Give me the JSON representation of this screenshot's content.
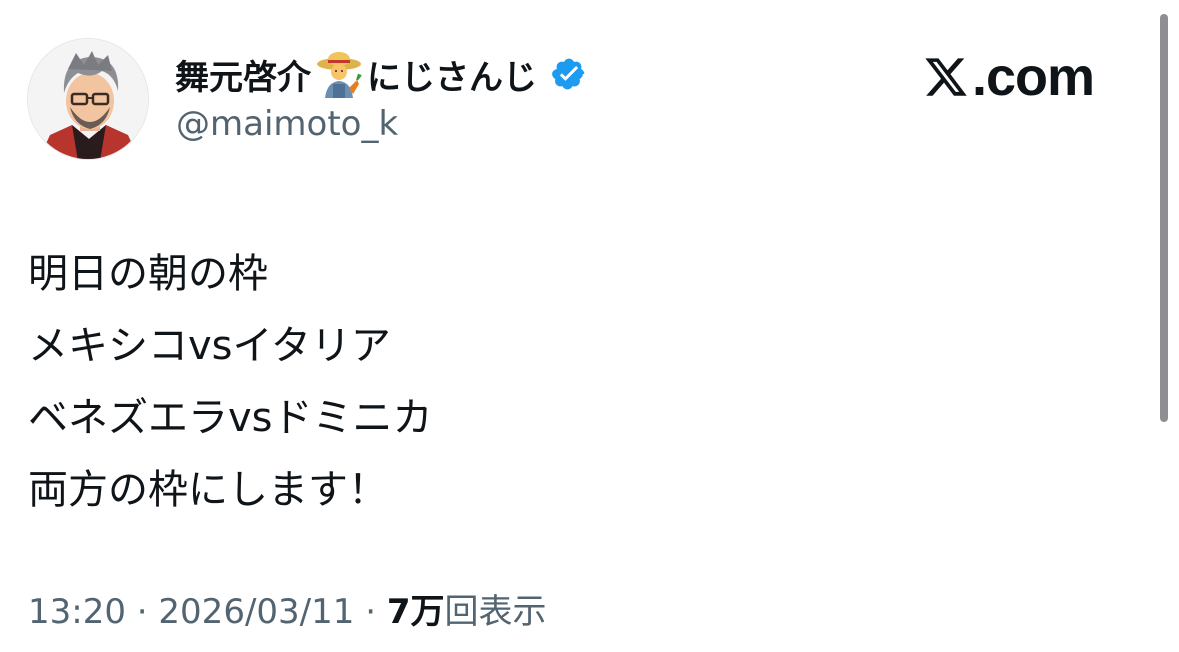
{
  "author": {
    "display_name": "舞元啓介",
    "name_emoji": "farmer-emoji",
    "name_suffix": "にじさんじ",
    "verified_icon": "verified-badge-icon",
    "handle": "@maimoto_k"
  },
  "brand": {
    "logo_text": ".com",
    "logo_icon": "x-logo-icon"
  },
  "tweet": {
    "lines": [
      "明日の朝の枠",
      "メキシコvsイタリア",
      "ベネズエラvsドミニカ",
      "両方の枠にします！"
    ]
  },
  "meta": {
    "time": "13:20",
    "separator": " · ",
    "date": "2026/03/11",
    "views_count": "7万",
    "views_label": "回表示"
  },
  "colors": {
    "text": "#0f1419",
    "secondary": "#536471",
    "verified": "#1d9bf0",
    "scrollbar": "#8e8e93"
  }
}
